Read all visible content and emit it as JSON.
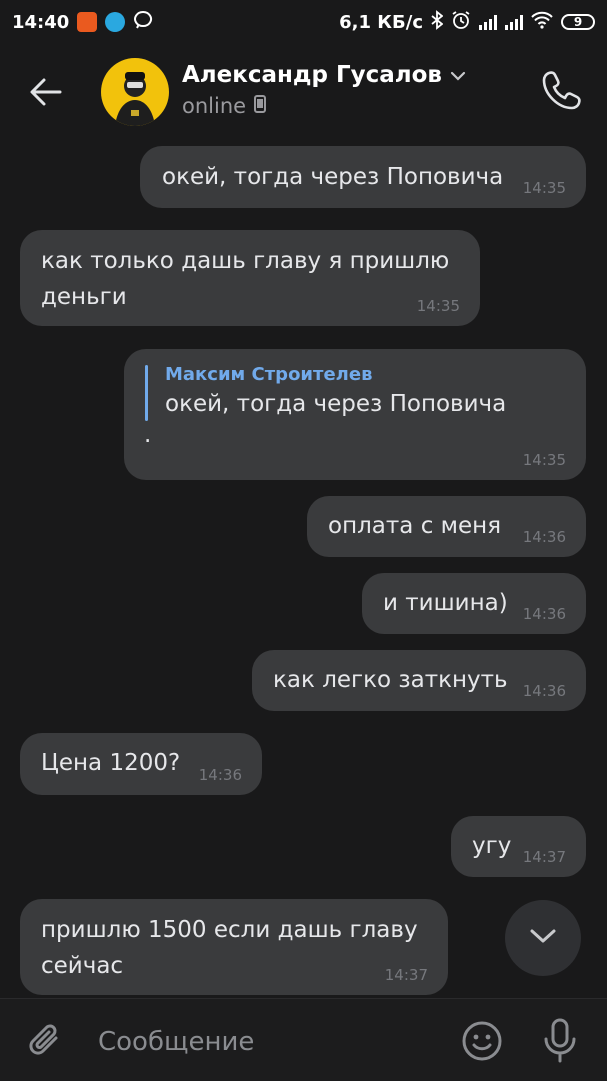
{
  "status_bar": {
    "time": "14:40",
    "net_speed": "6,1 КБ/с",
    "battery": "9"
  },
  "header": {
    "contact_name": "Александр Гусалов",
    "status": "online"
  },
  "messages": [
    {
      "side": "out",
      "text": "окей, тогда через Поповича",
      "time": "14:35"
    },
    {
      "side": "in",
      "text": "как только дашь главу я пришлю\nденьги",
      "time": "14:35"
    },
    {
      "side": "out",
      "reply_author": "Максим Строителев",
      "reply_text": "окей, тогда через Поповича",
      "text": ".",
      "time": "14:35"
    },
    {
      "side": "out",
      "text": "оплата с меня",
      "time": "14:36"
    },
    {
      "side": "out",
      "text": "и тишина)",
      "time": "14:36"
    },
    {
      "side": "out",
      "text": "как легко заткнуть",
      "time": "14:36"
    },
    {
      "side": "in",
      "text": "Цена 1200?",
      "time": "14:36"
    },
    {
      "side": "out",
      "text": "угу",
      "time": "14:37"
    },
    {
      "side": "in",
      "text": "пришлю 1500 если дашь главу\nсейчас",
      "time": "14:37"
    }
  ],
  "composer": {
    "placeholder": "Сообщение"
  },
  "colors": {
    "background": "#19191a",
    "bubble": "#3a3b3d",
    "accent": "#71aaeb",
    "avatar_bg": "#f2c20c"
  }
}
